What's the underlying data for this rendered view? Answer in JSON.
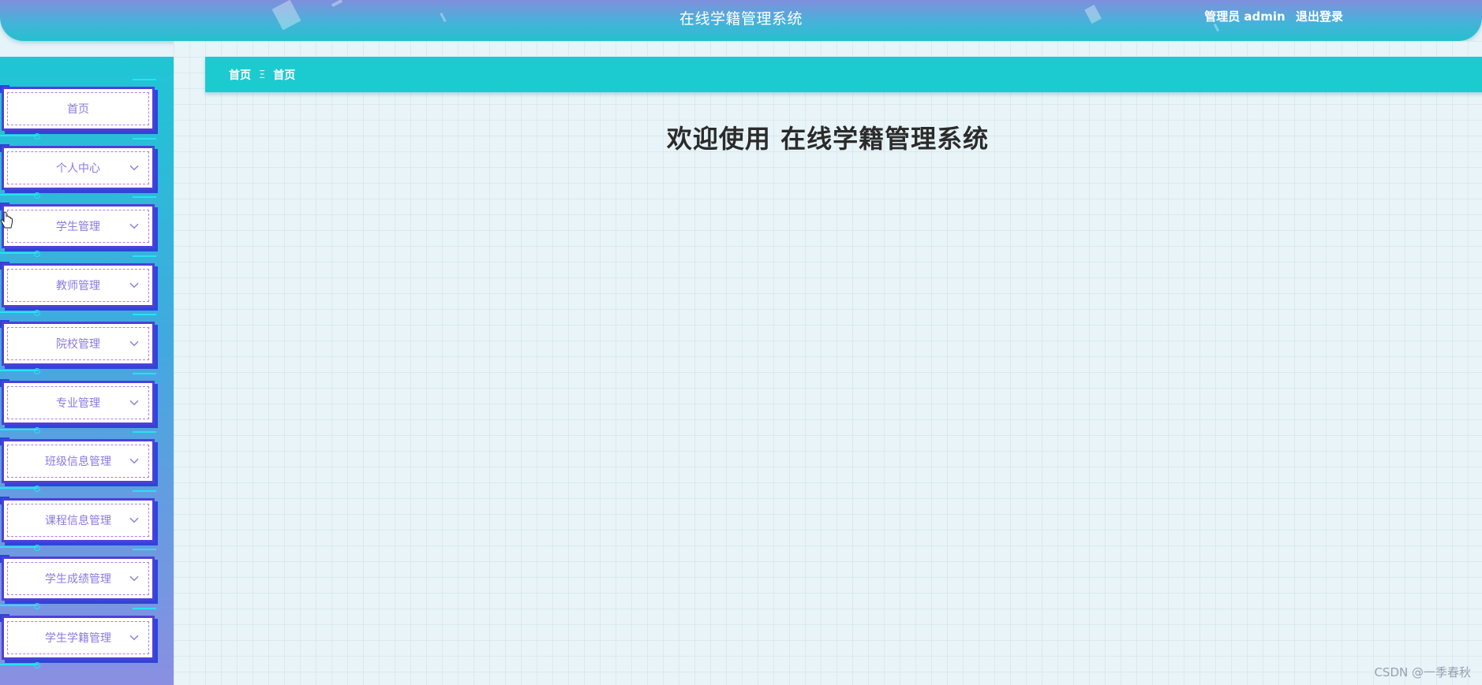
{
  "header": {
    "title": "在线学籍管理系统",
    "user_label": "管理员 admin",
    "logout_label": "退出登录"
  },
  "breadcrumb": {
    "items": [
      "首页",
      "首页"
    ],
    "separator": "Ξ"
  },
  "welcome_text": "欢迎使用 在线学籍管理系统",
  "sidebar": {
    "items": [
      {
        "label": "首页",
        "has_submenu": false
      },
      {
        "label": "个人中心",
        "has_submenu": true
      },
      {
        "label": "学生管理",
        "has_submenu": true
      },
      {
        "label": "教师管理",
        "has_submenu": true
      },
      {
        "label": "院校管理",
        "has_submenu": true
      },
      {
        "label": "专业管理",
        "has_submenu": true
      },
      {
        "label": "班级信息管理",
        "has_submenu": true
      },
      {
        "label": "课程信息管理",
        "has_submenu": true
      },
      {
        "label": "学生成绩管理",
        "has_submenu": true
      },
      {
        "label": "学生学籍管理",
        "has_submenu": true
      }
    ]
  },
  "watermark": "CSDN @一季春秋",
  "colors": {
    "header_gradient_top": "#7f8fdc",
    "header_gradient_bottom": "#25c0cf",
    "breadcrumb_bg": "#1ccbd0",
    "menu_border": "#4f3fd9",
    "menu_text": "#8a7ae0",
    "welcome_text": "#2b2b2b"
  },
  "icons": {
    "submenu_chevron": "chevron-down-icon",
    "breadcrumb_separator": "menu-separator-icon",
    "cursor": "hand-pointer-icon"
  }
}
